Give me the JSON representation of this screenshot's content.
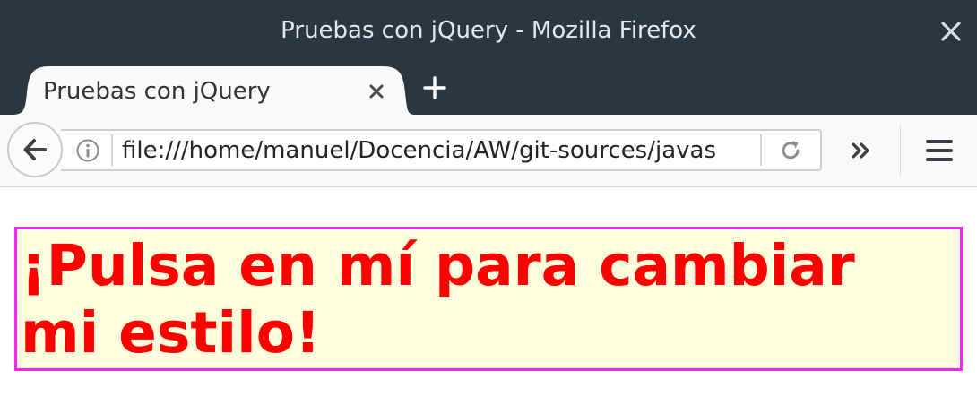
{
  "window": {
    "title": "Pruebas con jQuery - Mozilla Firefox"
  },
  "tabs": [
    {
      "label": "Pruebas con jQuery",
      "active": true
    }
  ],
  "navbar": {
    "url": "file:///home/manuel/Docencia/AW/git-sources/javas"
  },
  "page": {
    "clickable_text": "¡Pulsa en mí para cambiar mi estilo!"
  },
  "icons": {
    "window_close": "close-icon",
    "tab_close": "close-icon",
    "new_tab": "plus-icon",
    "back": "back-arrow-icon",
    "info": "info-icon",
    "reload": "reload-icon",
    "overflow": "chevron-double-right-icon",
    "menu": "hamburger-menu-icon"
  },
  "colors": {
    "titlebar_bg": "#2b3740",
    "toolbar_bg": "#f9f9fa",
    "box_border": "#ff1fff",
    "box_background": "#ffffdd",
    "box_text": "#ff0000"
  }
}
